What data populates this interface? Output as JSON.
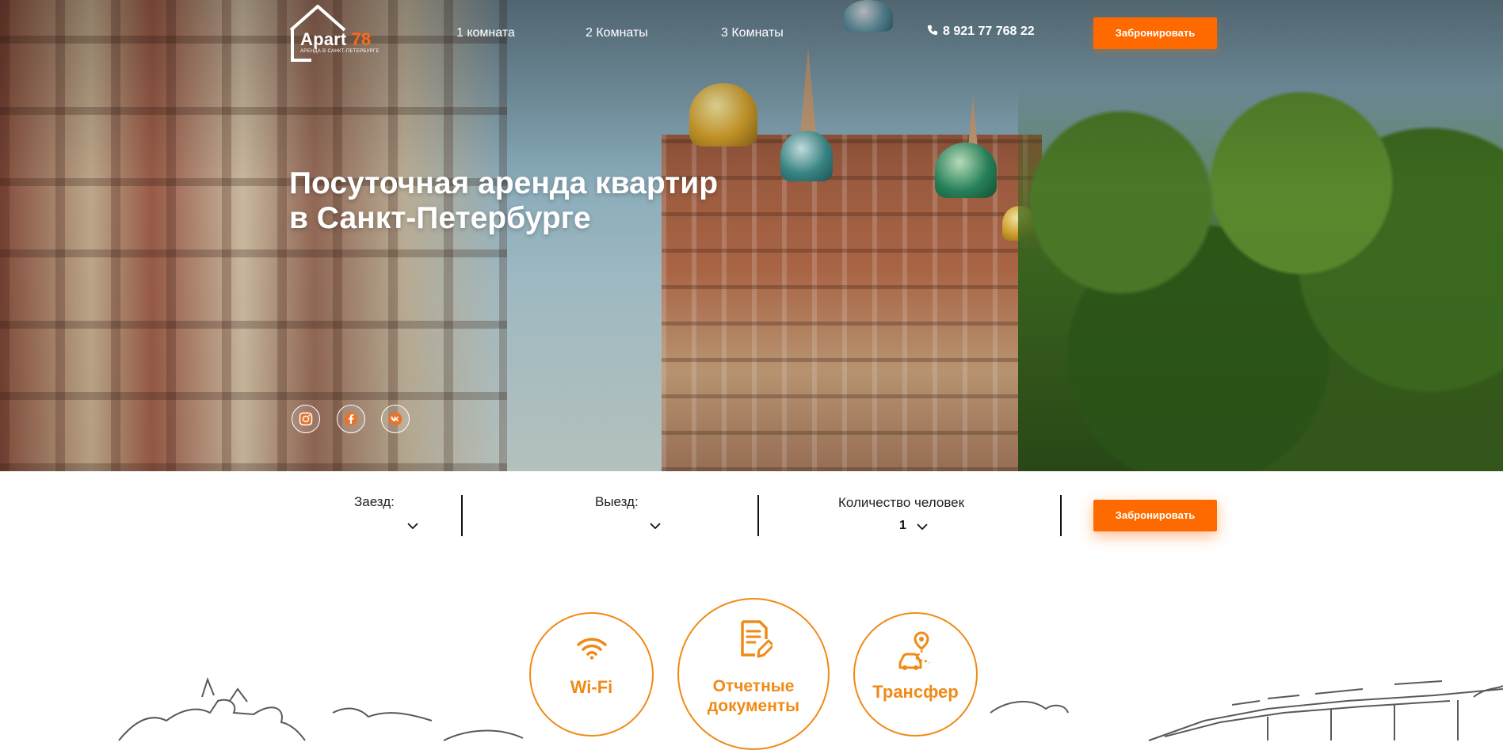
{
  "header": {
    "logo": {
      "brand": "Apart",
      "number": "78",
      "tagline": "АРЕНДА В САНКТ-ПЕТЕРБУРГЕ",
      "icon": "house-outline-icon"
    },
    "nav": [
      {
        "label": "1 комната"
      },
      {
        "label": "2 Комнаты"
      },
      {
        "label": "3 Комнаты"
      }
    ],
    "phone": "8 921 77 768 22",
    "phone_icon": "phone-icon",
    "book_label": "Забронировать"
  },
  "hero": {
    "title_line1": "Посуточная аренда квартир",
    "title_line2": "в Санкт-Петербурге"
  },
  "social": [
    {
      "icon": "instagram-icon"
    },
    {
      "icon": "facebook-icon"
    },
    {
      "icon": "vk-icon"
    }
  ],
  "booking": {
    "checkin_label": "Заезд:",
    "checkout_label": "Выезд:",
    "people_label": "Количество человек",
    "people_value": "1",
    "book_label": "Забронировать"
  },
  "features": [
    {
      "label": "Wi-Fi",
      "icon": "wifi-icon"
    },
    {
      "label_line1": "Отчетные",
      "label_line2": "документы",
      "icon": "document-edit-icon"
    },
    {
      "label": "Трансфер",
      "icon": "transfer-car-icon"
    }
  ],
  "colors": {
    "accent": "#ff6a00",
    "feature": "#f08a16"
  }
}
